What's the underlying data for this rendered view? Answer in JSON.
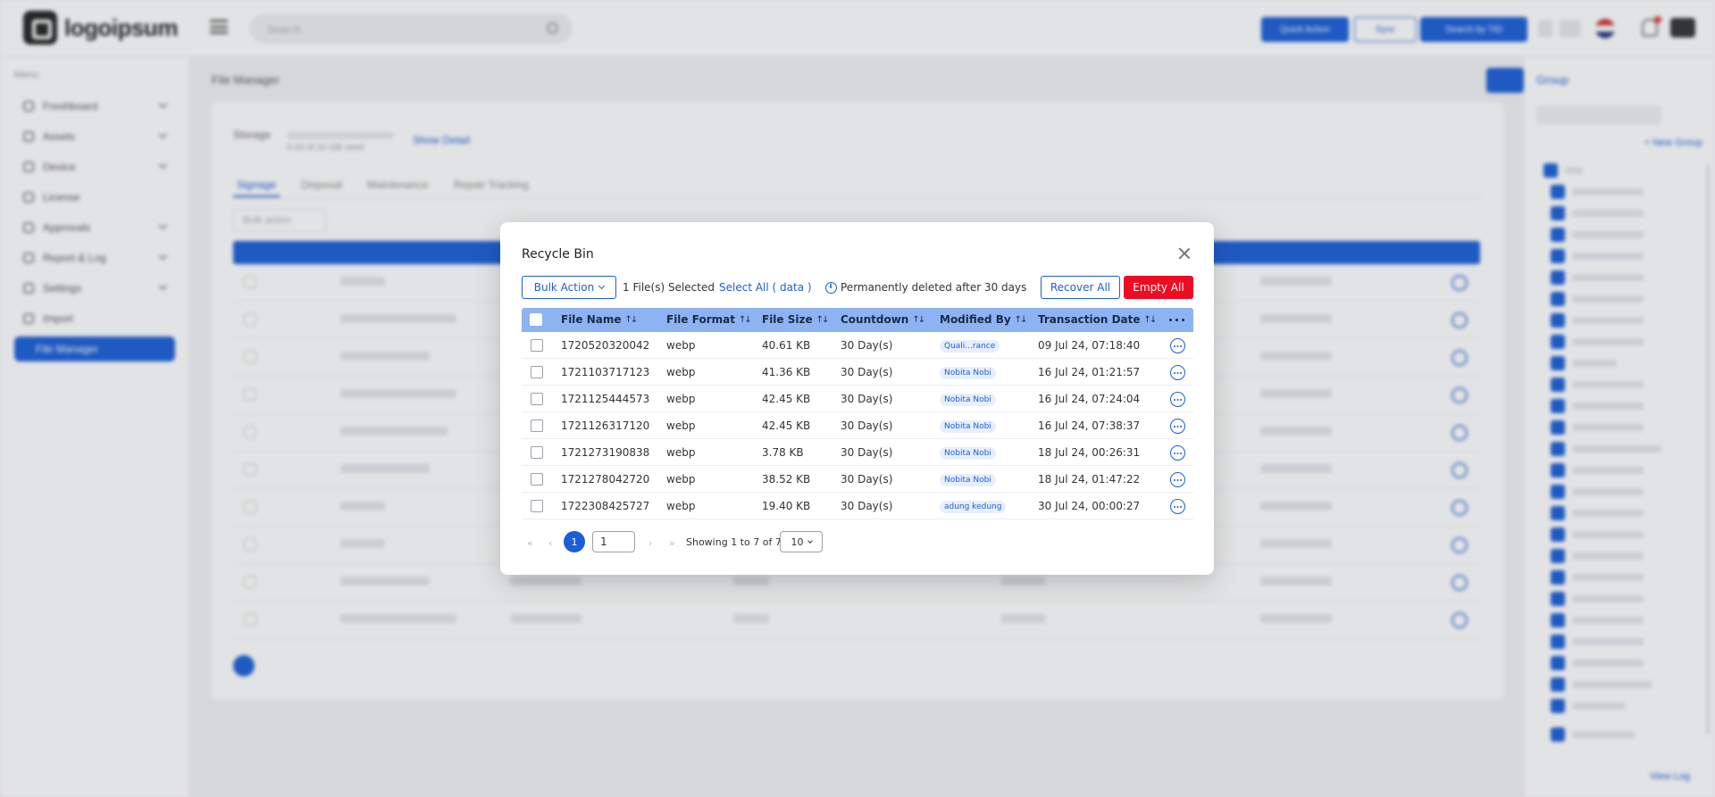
{
  "background": {
    "brand": "logoipsum",
    "topbar": {
      "search_placeholder": "Search",
      "btn_quick_action": "Quick Action",
      "btn_sync": "Sync",
      "btn_search_tid": "Search by TID"
    },
    "sidebar": {
      "heading": "Menu",
      "items": [
        {
          "label": "Freshboard"
        },
        {
          "label": "Assets"
        },
        {
          "label": "Device"
        },
        {
          "label": "License"
        },
        {
          "label": "Approvals"
        },
        {
          "label": "Report & Log"
        },
        {
          "label": "Settings"
        },
        {
          "label": "Import"
        },
        {
          "label": "File Manager"
        }
      ]
    },
    "page_title": "File Manager",
    "storage_label": "Storage",
    "storage_sub": "0.43 of 10 GB used",
    "storage_link": "Show Detail",
    "tabs": [
      "Signage",
      "Disposal",
      "Maintenance",
      "Repair Tracking"
    ],
    "bulk_action": "Bulk action",
    "right_panel": {
      "title": "Group",
      "new_group": "+ New Group",
      "view_log": "View Log"
    }
  },
  "modal": {
    "title": "Recycle Bin",
    "bulk_action": "Bulk Action",
    "selected_text": "1 File(s) Selected",
    "select_all": "Select All ( data )",
    "info": "Permanently deleted after 30 days",
    "recover_all": "Recover All",
    "empty_all": "Empty All",
    "columns": {
      "file_name": "File Name",
      "file_format": "File Format",
      "file_size": "File Size",
      "countdown": "Countdown",
      "modified_by": "Modified By",
      "transaction_date": "Transaction Date"
    },
    "rows": [
      {
        "name": "1720520320042",
        "format": "webp",
        "size": "40.61 KB",
        "countdown": "30 Day(s)",
        "modified_by": "Quali...rance",
        "date": "09 Jul 24, 07:18:40"
      },
      {
        "name": "1721103717123",
        "format": "webp",
        "size": "41.36 KB",
        "countdown": "30 Day(s)",
        "modified_by": "Nobita Nobi",
        "date": "16 Jul 24, 01:21:57"
      },
      {
        "name": "1721125444573",
        "format": "webp",
        "size": "42.45 KB",
        "countdown": "30 Day(s)",
        "modified_by": "Nobita Nobi",
        "date": "16 Jul 24, 07:24:04"
      },
      {
        "name": "1721126317120",
        "format": "webp",
        "size": "42.45 KB",
        "countdown": "30 Day(s)",
        "modified_by": "Nobita Nobi",
        "date": "16 Jul 24, 07:38:37"
      },
      {
        "name": "1721273190838",
        "format": "webp",
        "size": "3.78 KB",
        "countdown": "30 Day(s)",
        "modified_by": "Nobita Nobi",
        "date": "18 Jul 24, 00:26:31"
      },
      {
        "name": "1721278042720",
        "format": "webp",
        "size": "38.52 KB",
        "countdown": "30 Day(s)",
        "modified_by": "Nobita Nobi",
        "date": "18 Jul 24, 01:47:22"
      },
      {
        "name": "1722308425727",
        "format": "webp",
        "size": "19.40 KB",
        "countdown": "30 Day(s)",
        "modified_by": "adung kedung",
        "date": "30 Jul 24, 00:00:27"
      }
    ],
    "pagination": {
      "current_page": "1",
      "page_input": "1",
      "info": "Showing 1 to 7 of 7",
      "page_size": "10"
    }
  }
}
